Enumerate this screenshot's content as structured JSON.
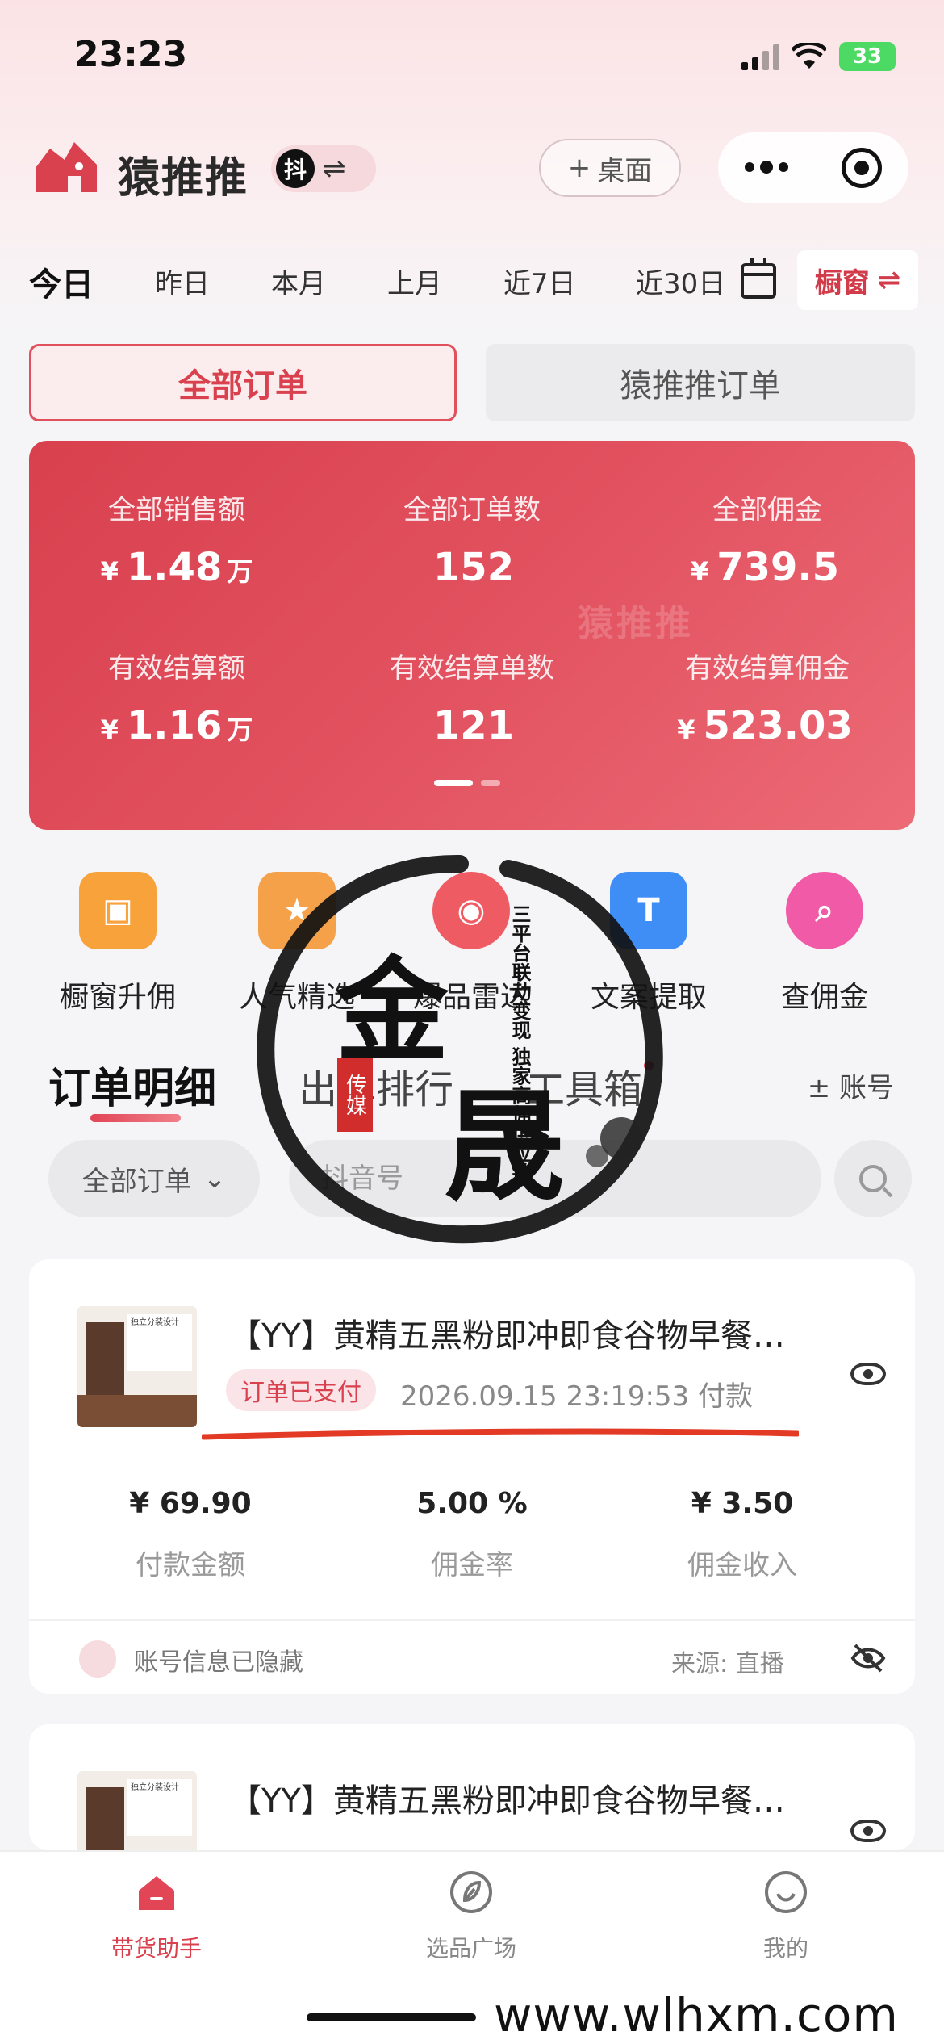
{
  "status_bar": {
    "time": "23:23",
    "battery": "33"
  },
  "header": {
    "app_name": "猿推推",
    "platform_badge": "抖",
    "swap_glyph": "⇌",
    "desktop_button": "桌面",
    "desktop_plus": "+"
  },
  "date_tabs": [
    "今日",
    "昨日",
    "本月",
    "上月",
    "近7日",
    "近30日"
  ],
  "window_toggle": {
    "label": "橱窗",
    "glyph": "⇌"
  },
  "order_switch": {
    "all": "全部订单",
    "app": "猿推推订单"
  },
  "stats": [
    {
      "label": "全部销售额",
      "currency": "¥",
      "value": "1.48",
      "unit": "万"
    },
    {
      "label": "全部订单数",
      "currency": "",
      "value": "152",
      "unit": ""
    },
    {
      "label": "全部佣金",
      "currency": "¥",
      "value": "739.5",
      "unit": ""
    },
    {
      "label": "有效结算额",
      "currency": "¥",
      "value": "1.16",
      "unit": "万"
    },
    {
      "label": "有效结算单数",
      "currency": "",
      "value": "121",
      "unit": ""
    },
    {
      "label": "有效结算佣金",
      "currency": "¥",
      "value": "523.03",
      "unit": ""
    }
  ],
  "stats_watermark": "猿推推",
  "tools": [
    {
      "label": "橱窗升佣",
      "color": "#f7a23b",
      "glyph": "▣"
    },
    {
      "label": "人气精选",
      "color": "#f5a14a",
      "glyph": "★"
    },
    {
      "label": "爆品雷达",
      "color": "#ef5b63",
      "glyph": "◉"
    },
    {
      "label": "文案提取",
      "color": "#3f8ef6",
      "glyph": "T"
    },
    {
      "label": "查佣金",
      "color": "#f05aa6",
      "glyph": "⌕"
    }
  ],
  "section_tabs": {
    "detail": "订单明细",
    "ranking": "出单排行",
    "toolbox": "工具箱",
    "account": "± 账号"
  },
  "filter": {
    "select_label": "全部订单",
    "select_caret": "⌄",
    "input_placeholder": "抖音号"
  },
  "orders": [
    {
      "title": "【YY】黄精五黑粉即冲即食谷物早餐…",
      "status": "订单已支付",
      "pay_time": "2026.09.15 23:19:53 付款",
      "amount": "¥ 69.90",
      "amount_label": "付款金额",
      "rate": "5.00 %",
      "rate_label": "佣金率",
      "commission": "¥ 3.50",
      "commission_label": "佣金收入",
      "account_note": "账号信息已隐藏",
      "source": "来源:  直播",
      "thumb_text": "独立分装设计"
    },
    {
      "title": "【YY】黄精五黑粉即冲即食谷物早餐…",
      "thumb_text": "独立分装设计"
    }
  ],
  "bottom_nav": [
    {
      "label": "带货助手",
      "active": true
    },
    {
      "label": "选品广场",
      "active": false
    },
    {
      "label": "我的",
      "active": false
    }
  ],
  "watermark": {
    "char1": "金",
    "char2": "晟",
    "stamp": "传媒",
    "side_text": "三平台联动变现 独家高佣供应链"
  },
  "site_url": "www.wlhxm.com",
  "colors": {
    "brand_red": "#d9414e",
    "card_red": "#e2515f"
  }
}
